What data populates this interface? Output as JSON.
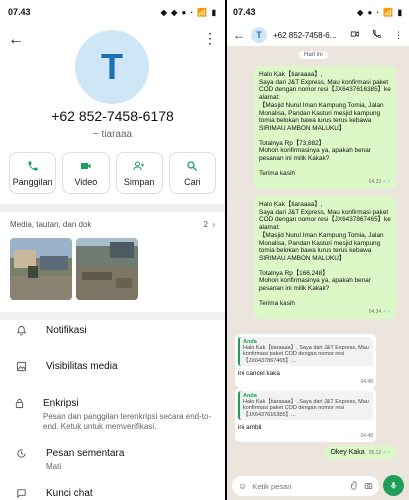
{
  "left": {
    "status": {
      "time": "07.43",
      "icons": "◆ ◆ ● · 📶 ▮"
    },
    "avatar_letter": "T",
    "phone": "+62 852-7458-6178",
    "nickname": "~ tiaraaa",
    "actions": [
      {
        "label": "Panggilan",
        "icon": "phone-icon"
      },
      {
        "label": "Video",
        "icon": "video-icon"
      },
      {
        "label": "Simpan",
        "icon": "add-contact-icon"
      },
      {
        "label": "Cari",
        "icon": "search-icon"
      }
    ],
    "media": {
      "title": "Media, tautan, dan dok",
      "count": "2"
    },
    "rows": [
      {
        "title": "Notifikasi",
        "sub": ""
      },
      {
        "title": "Visibilitas media",
        "sub": ""
      },
      {
        "title": "Enkripsi",
        "sub": "Pesan dan panggilan terenkripsi secara end-to-end. Ketuk untuk memverifikasi."
      },
      {
        "title": "Pesan sementara",
        "sub": "Mati"
      },
      {
        "title": "Kunci chat",
        "sub": ""
      }
    ]
  },
  "right": {
    "status": {
      "time": "07.43",
      "icons": "◆ ● · 📶 ▮"
    },
    "header": {
      "avatar_letter": "T",
      "number": "+62 852-7458-6..."
    },
    "day_chip": "Hari ini",
    "msg1": {
      "lines": [
        "Halo Kak【tiaraaaa】,",
        "Saya dari J&T Express, Mau konfirmasi paket COD dengan nomor resi【JX6437616385】ke alamat:",
        "【Masjid Nurul Iman Kampung Tomia, Jalan Monalisa, Pandan Kasturi  mesjid kampung tomia belokan bawa lurus terus kebawa SIRIMAU AMBON MALUKU】",
        "",
        "Totalnya Rp【73,882】",
        "Mohon konfirmasinya ya, apakah benar pesanan ini milik Kakak?",
        "",
        "Terima kasih"
      ],
      "time": "04.33"
    },
    "msg2": {
      "lines": [
        "Halo Kak【tiaraaaa】,",
        "Saya dari J&T Express, Mau konfirmasi paket COD dengan nomor resi【JX6437867465】ke alamat:",
        "【Masjid Nurul Iman Kampung Tomia, Jalan Monalisa, Pandan Kasturi  mesjid kampung tomia belokan bawa lurus terus kebawa SIRIMAU AMBON MALUKU】",
        "",
        "Totalnya Rp【166,248】",
        "Mohon konfirmasinya ya, apakah benar pesanan ini milik Kakak?",
        "",
        "Terima kasih"
      ],
      "time": "04.34"
    },
    "reply1": {
      "quote_author": "Anda",
      "quote_text": "Halo Kak【tiaraaaa】, Saya dari J&T Express, Mau konfirmasi paket COD dengan nomor resi【JX6437867465】...",
      "text": "ini cancel kaka",
      "time": "04.48"
    },
    "reply2": {
      "quote_author": "Anda",
      "quote_text": "Halo Kak【tiaraaaa】, Saya dari J&T Express, Mau konfirmasi paket COD dengan nomor resi【JX6437616385】...",
      "text": "ini ambil",
      "time": "04.48"
    },
    "msg3": {
      "text": "Okey Kaka",
      "time": "05.12"
    },
    "composer_placeholder": "Ketik pesan"
  }
}
